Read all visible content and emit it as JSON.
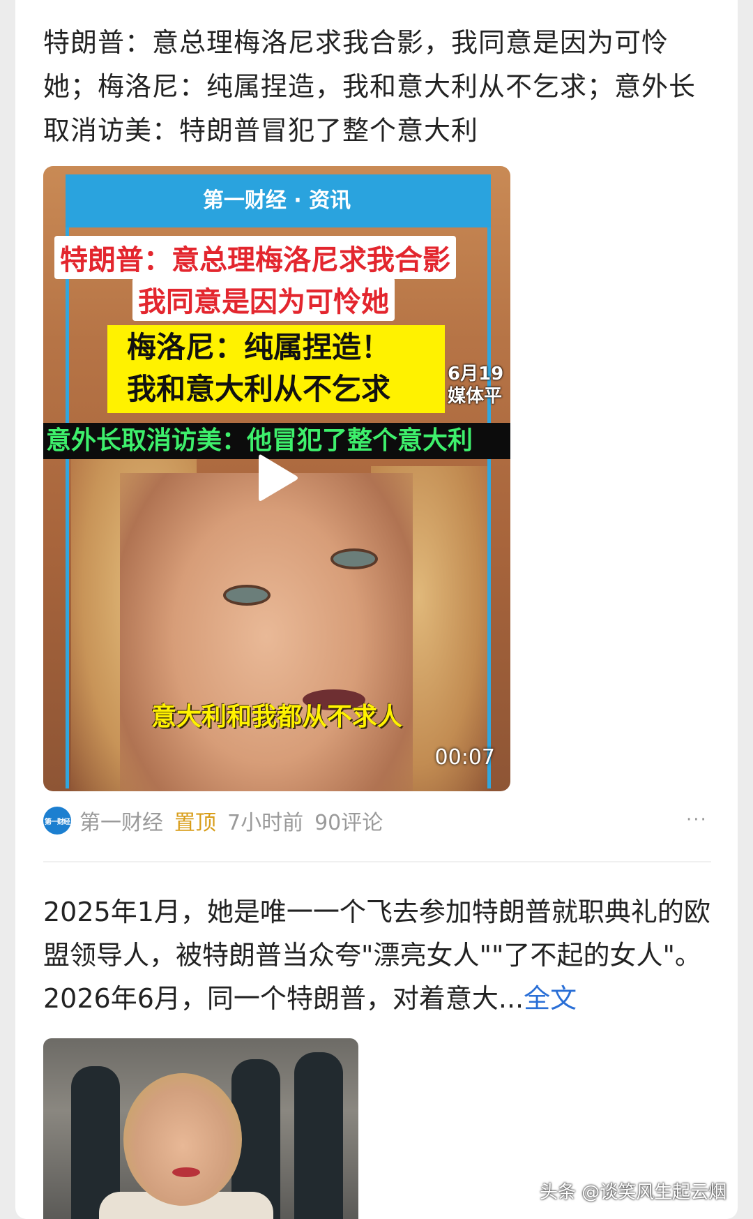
{
  "post1": {
    "headline": "特朗普：意总理梅洛尼求我合影，我同意是因为可怜她；梅洛尼：纯属捏造，我和意大利从不乞求；意外长取消访美：特朗普冒犯了整个意大利",
    "video": {
      "brand": "第一财经 · 资讯",
      "caption_red_1": "特朗普：意总理梅洛尼求我合影",
      "caption_red_2": "我同意是因为可怜她",
      "caption_yellow_1": "梅洛尼：纯属捏造！",
      "caption_yellow_2": "我和意大利从不乞求",
      "date_tag_1": "6月19",
      "date_tag_2": "媒体平",
      "caption_green": "意外长取消访美：他冒犯了整个意大利",
      "subtitle": "意大利和我都从不求人",
      "duration": "00:07"
    },
    "meta": {
      "source_icon_text": "第一财经",
      "source": "第一财经",
      "pinned": "置顶",
      "time": "7小时前",
      "comments": "90评论",
      "more": "···"
    }
  },
  "post2": {
    "text": "2025年1月，她是唯一一个飞去参加特朗普就职典礼的欧盟领导人，被特朗普当众夸\"漂亮女人\"\"了不起的女人\"。2026年6月，同一个特朗普，对着意大...",
    "full_text_link": "全文"
  },
  "watermark": "头条 @谈笑风生起云烟",
  "colors": {
    "accent_link": "#2a6fd6",
    "pinned": "#d89d19",
    "video_brand_blue": "#2aa3de"
  },
  "icons": {
    "play": "play-icon",
    "more": "more-dots-icon",
    "source": "source-avatar-icon"
  }
}
